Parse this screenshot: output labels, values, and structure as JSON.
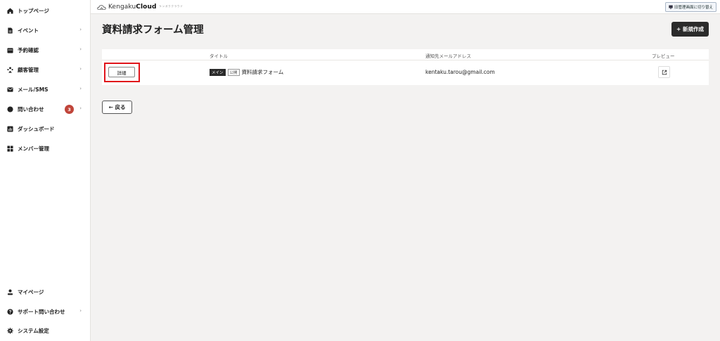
{
  "sidebar": {
    "items": [
      {
        "label": "トップページ",
        "icon": "home-icon",
        "chevron": ""
      },
      {
        "label": "イベント",
        "icon": "document-icon",
        "chevron": "›"
      },
      {
        "label": "予約確認",
        "icon": "calendar-icon",
        "chevron": "›"
      },
      {
        "label": "顧客管理",
        "icon": "users-icon",
        "chevron": "›"
      },
      {
        "label": "メール/SMS",
        "icon": "mail-icon",
        "chevron": "›"
      },
      {
        "label": "問い合わせ",
        "icon": "chat-icon",
        "chevron": "›",
        "badge": "3"
      },
      {
        "label": "ダッシュボード",
        "icon": "chart-icon",
        "chevron": ""
      },
      {
        "label": "メンバー管理",
        "icon": "grid-icon",
        "chevron": ""
      }
    ],
    "bottom_items": [
      {
        "label": "マイページ",
        "icon": "person-icon",
        "chevron": ""
      },
      {
        "label": "サポート問い合わせ",
        "icon": "help-icon",
        "chevron": "›"
      },
      {
        "label": "システム設定",
        "icon": "gear-icon",
        "chevron": ""
      }
    ]
  },
  "topbar": {
    "logo_regular": "Kengaku",
    "logo_bold": "Cloud",
    "logo_sub": "ケンガククラウド",
    "switch_label": "旧管理画面に切り替え"
  },
  "main": {
    "page_title": "資料請求フォーム管理",
    "new_button": "+ 新規作成",
    "table": {
      "headers": {
        "title": "タイトル",
        "email": "通知先メールアドレス",
        "preview": "プレビュー"
      },
      "rows": [
        {
          "detail_label": "詳細",
          "tag_main": "メイン",
          "tag_public": "公開",
          "title": "資料請求フォーム",
          "email": "kentaku.tarou@gmail.com"
        }
      ]
    },
    "back_button": "← 戻る"
  },
  "colors": {
    "accent_dark": "#2b2b2b",
    "badge": "#c0453a",
    "highlight": "#e0141b",
    "background": "#f3f2f1"
  }
}
